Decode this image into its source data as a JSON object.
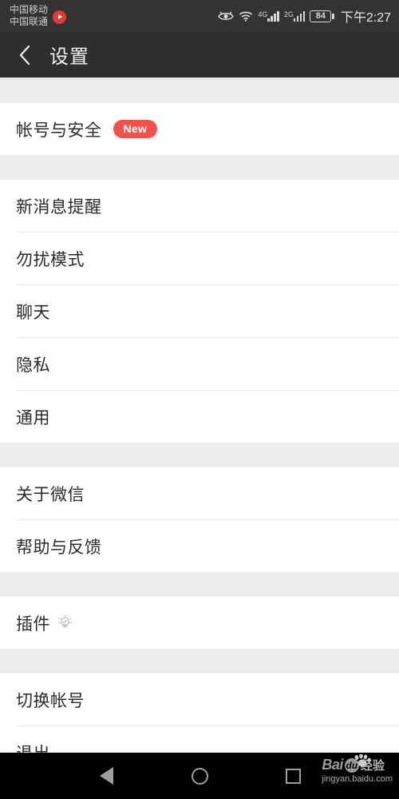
{
  "status_bar": {
    "carrier_primary": "中国移动",
    "carrier_secondary": "中国联通",
    "record_icon": "record-icon",
    "eye_icon": "eye-icon",
    "wifi_icon": "wifi-icon",
    "signal_1_label": "4G",
    "signal_2_label": "2G",
    "battery_level": "84",
    "clock": "下午2:27"
  },
  "header": {
    "back_icon": "back-chevron-icon",
    "title": "设置"
  },
  "sections": [
    {
      "rows": [
        {
          "label": "帐号与安全",
          "badge": "New",
          "icon": null
        }
      ]
    },
    {
      "rows": [
        {
          "label": "新消息提醒",
          "badge": null,
          "icon": null
        },
        {
          "label": "勿扰模式",
          "badge": null,
          "icon": null
        },
        {
          "label": "聊天",
          "badge": null,
          "icon": null
        },
        {
          "label": "隐私",
          "badge": null,
          "icon": null
        },
        {
          "label": "通用",
          "badge": null,
          "icon": null
        }
      ]
    },
    {
      "rows": [
        {
          "label": "关于微信",
          "badge": null,
          "icon": null
        },
        {
          "label": "帮助与反馈",
          "badge": null,
          "icon": null
        }
      ]
    },
    {
      "rows": [
        {
          "label": "插件",
          "badge": null,
          "icon": "lightbulb-icon"
        }
      ]
    },
    {
      "rows": [
        {
          "label": "切换帐号",
          "badge": null,
          "icon": null
        },
        {
          "label": "退出",
          "badge": null,
          "icon": null
        }
      ]
    }
  ],
  "nav_bar": {
    "back": "back-triangle-icon",
    "home": "home-circle-icon",
    "recents": "recents-square-icon"
  },
  "watermark": {
    "bai": "Bai",
    "du": "du",
    "jingyan": "经验",
    "url": "jingyan.baidu.com"
  },
  "colors": {
    "status_bar_bg": "#333333",
    "title_bar_bg": "#2e2e2e",
    "badge_red": "#f5504a",
    "section_gap": "#ececec",
    "divider": "#eceaea",
    "row_text": "#2b2b2b"
  }
}
